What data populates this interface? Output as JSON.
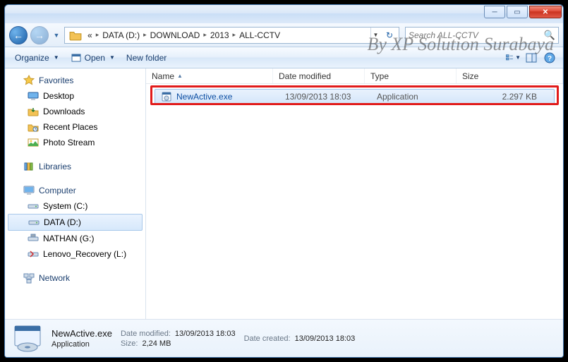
{
  "titlebar": {
    "min": "_",
    "max": "□",
    "close": "×"
  },
  "nav": {
    "crumbs": [
      "«",
      "DATA (D:)",
      "DOWNLOAD",
      "2013",
      "ALL-CCTV"
    ],
    "search_placeholder": "Search ALL-CCTV"
  },
  "toolbar": {
    "organize": "Organize",
    "open": "Open",
    "newfolder": "New folder"
  },
  "sidebar": {
    "favorites": {
      "label": "Favorites",
      "items": [
        "Desktop",
        "Downloads",
        "Recent Places",
        "Photo Stream"
      ]
    },
    "libraries": {
      "label": "Libraries"
    },
    "computer": {
      "label": "Computer",
      "items": [
        "System (C:)",
        "DATA (D:)",
        "NATHAN (G:)",
        "Lenovo_Recovery (L:)"
      ],
      "selected_index": 1
    },
    "network": {
      "label": "Network"
    }
  },
  "columns": {
    "name": "Name",
    "date": "Date modified",
    "type": "Type",
    "size": "Size"
  },
  "file": {
    "name": "NewActive.exe",
    "date": "13/09/2013 18:03",
    "type": "Application",
    "size": "2.297 KB"
  },
  "details": {
    "name": "NewActive.exe",
    "type": "Application",
    "date_modified_label": "Date modified:",
    "date_modified": "13/09/2013 18:03",
    "size_label": "Size:",
    "size": "2,24 MB",
    "date_created_label": "Date created:",
    "date_created": "13/09/2013 18:03"
  },
  "watermark": "By XP Solution Surabaya"
}
